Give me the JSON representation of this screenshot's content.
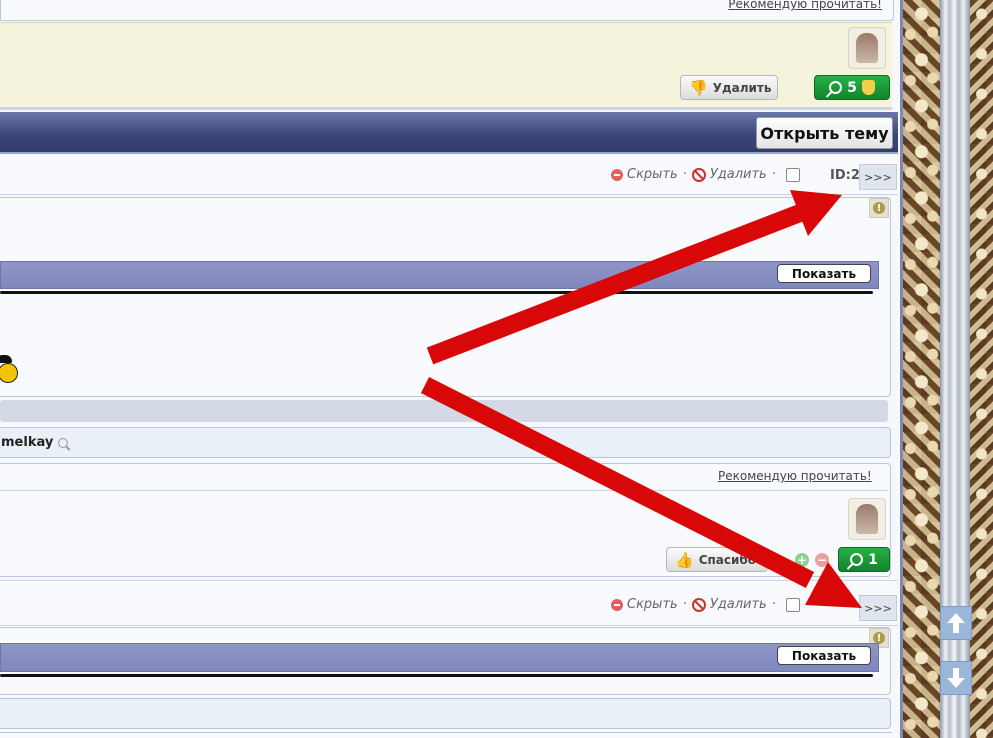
{
  "post1": {
    "recommend_link": "Рекомендую прочитать!",
    "delete_button": "Удалить",
    "reputation_count": "5"
  },
  "topic": {
    "open_topic_button": "Открыть тему"
  },
  "post2": {
    "hide_link": "Скрыть",
    "delete_link": "Удалить",
    "separator": "·",
    "id_label": "ID:2",
    "more_button": ">>>",
    "warn_symbol": "!",
    "spoiler_button": "Показать",
    "author_name": "melkay",
    "recommend_link": "Рекомендую прочитать!",
    "thanks_button": "Спасибо",
    "plus_symbol": "+",
    "minus_symbol": "−",
    "reputation_count": "1"
  },
  "post3": {
    "hide_link": "Скрыть",
    "delete_link": "Удалить",
    "separator": "·",
    "more_button": ">>>",
    "warn_symbol": "!",
    "spoiler_button": "Показать"
  },
  "colors": {
    "arrow": "#d90808",
    "topic_bar": "#3a4478",
    "green_button": "#1a9a36",
    "spoiler_header": "#8a90c3"
  },
  "icons": [
    "thumbs-down-icon",
    "thumbs-up-icon",
    "magnifier-icon",
    "shield-icon",
    "hide-icon",
    "ban-icon",
    "warning-icon",
    "plus-icon",
    "minus-icon",
    "scroll-up-icon",
    "scroll-down-icon"
  ]
}
